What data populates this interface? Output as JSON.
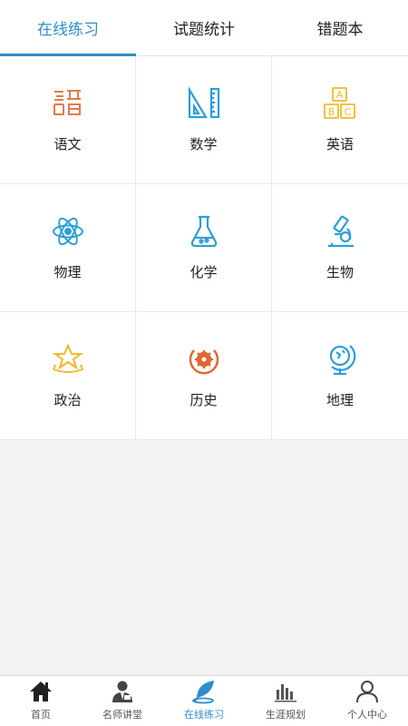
{
  "top_tabs": [
    {
      "label": "在线练习",
      "active": true
    },
    {
      "label": "试题统计",
      "active": false
    },
    {
      "label": "错题本",
      "active": false
    }
  ],
  "subjects": [
    {
      "label": "语文",
      "icon": "chinese-icon",
      "color": "#e07a4a"
    },
    {
      "label": "数学",
      "icon": "ruler-triangle-icon",
      "color": "#2d9fd6"
    },
    {
      "label": "英语",
      "icon": "abc-blocks-icon",
      "color": "#f0b929"
    },
    {
      "label": "物理",
      "icon": "atom-icon",
      "color": "#2d9fd6"
    },
    {
      "label": "化学",
      "icon": "flask-icon",
      "color": "#2d9fd6"
    },
    {
      "label": "生物",
      "icon": "microscope-icon",
      "color": "#2d9fd6"
    },
    {
      "label": "政治",
      "icon": "star-icon",
      "color": "#f0b929"
    },
    {
      "label": "历史",
      "icon": "gear-icon",
      "color": "#e0662f"
    },
    {
      "label": "地理",
      "icon": "globe-icon",
      "color": "#2d9fd6"
    }
  ],
  "bottom_nav": [
    {
      "label": "首页",
      "icon": "home-icon",
      "active": false
    },
    {
      "label": "名师讲堂",
      "icon": "teacher-icon",
      "active": false
    },
    {
      "label": "在线练习",
      "icon": "quill-icon",
      "active": true
    },
    {
      "label": "生涯规划",
      "icon": "bar-chart-icon",
      "active": false
    },
    {
      "label": "个人中心",
      "icon": "person-icon",
      "active": false
    }
  ],
  "colors": {
    "accent": "#2d8dcb"
  }
}
